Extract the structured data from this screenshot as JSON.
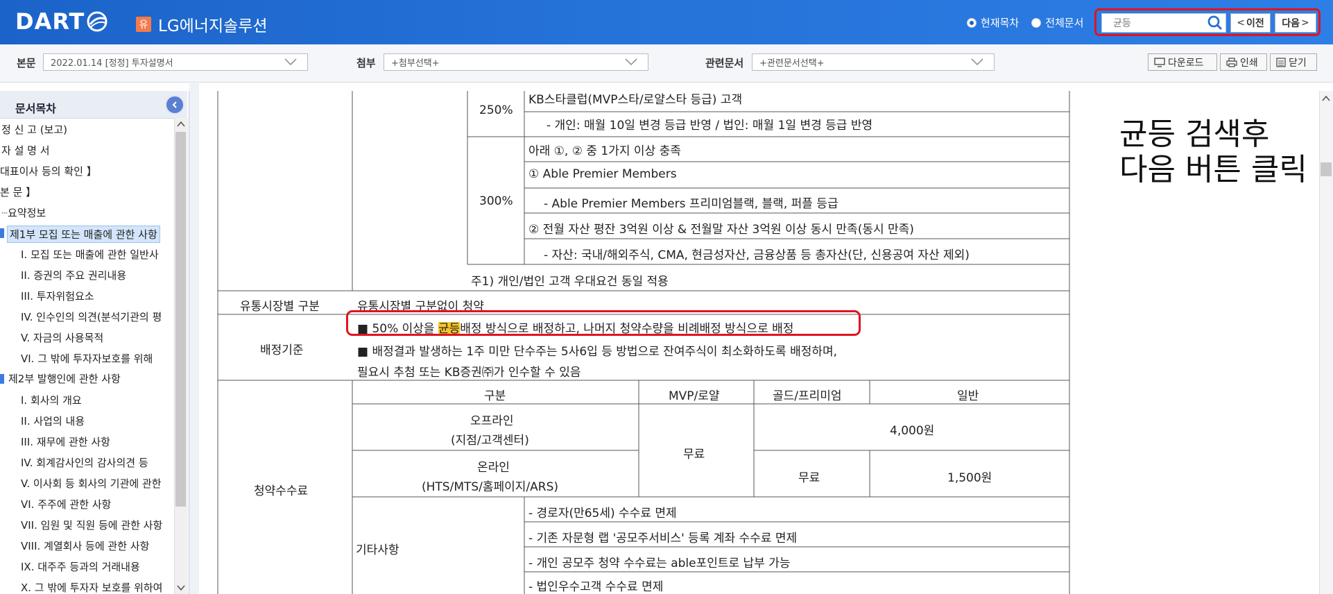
{
  "header": {
    "logo_text": "DART",
    "doc_badge": "유",
    "company_name": "LG에너지솔루션",
    "radio_current": "현재목차",
    "radio_all": "전체문서",
    "search_value": "균등",
    "prev_label": "이전",
    "next_label": "다음"
  },
  "toolbar": {
    "main_label": "본문",
    "main_select": "2022.01.14  [정정] 투자설명서",
    "attach_label": "첨부",
    "attach_select": "+첨부선택+",
    "related_label": "관련문서",
    "related_select": "+관련문서선택+",
    "download": "다운로드",
    "print": "인쇄",
    "close": "닫기"
  },
  "sidebar": {
    "title": "문서목차",
    "items": [
      "정 신 고 (보고)",
      "자 설 명 서",
      "대표이사 등의 확인 】",
      "본 문 】",
      "요약정보",
      "제1부 모집 또는 매출에 관한 사항",
      "I. 모집 또는 매출에 관한 일반사",
      "II. 증권의 주요 권리내용",
      "III. 투자위험요소",
      "IV. 인수인의 의견(분석기관의 평",
      "V. 자금의 사용목적",
      "VI. 그 밖에 투자자보호를 위해",
      "제2부 발행인에 관한 사항",
      "I. 회사의 개요",
      "II. 사업의 내용",
      "III. 재무에 관한 사항",
      "IV. 회계감사인의 감사의견 등",
      "V. 이사회 등 회사의 기관에 관한",
      "VI. 주주에 관한 사항",
      "VII. 임원 및 직원 등에 관한 사항",
      "VIII. 계열회사 등에 관한 사항",
      "IX. 대주주 등과의 거래내용",
      "X. 그 밖에 투자자 보호를 위하여"
    ]
  },
  "table": {
    "r250_pct": "250%",
    "r250_line1": "KB스타클럽(MVP스타/로얄스타 등급) 고객",
    "r250_line2": "- 개인: 매월 10일 변경 등급 반영 / 법인: 매월 1일 변경 등급 반영",
    "r300_pct": "300%",
    "r300_line1": "아래 ①, ② 중 1가지 이상 충족",
    "r300_line2": "① Able Premier Members",
    "r300_line3": "- Able Premier Members 프리미엄블랙, 블랙, 퍼플 등급",
    "r300_line4": "② 전월 자산 평잔 3억원 이상 & 전월말 자산 3억원 이상 동시 만족(동시 만족)",
    "r300_line5": "- 자산: 국내/해외주식, CMA, 현금성자산, 금융상품 등 총자산(단, 신용공여 자산 제외)",
    "note": "주1) 개인/법인 고객 우대요건 동일 적용",
    "market_label": "유통시장별 구분",
    "market_value": "유통시장별 구분없이 청약",
    "alloc_label": "배정기준",
    "alloc_line1_a": "■ 50% 이상을 ",
    "alloc_line1_hl": "균등",
    "alloc_line1_b": "배정 방식으로 배정하고, 나머지 청약수량을 비례배정 방식으로 배정",
    "alloc_line2": "■ 배정결과 발생하는 1주 미만 단수주는 5사6입 등 방법으로 잔여주식이 최소화하도록 배정하며,",
    "alloc_line3": "필요시 추첨 또는 KB증권㈜가 인수할 수 있음",
    "fee_label": "청약수수료",
    "fee_head_type": "구분",
    "fee_head_mvp": "MVP/로얄",
    "fee_head_gold": "골드/프리미엄",
    "fee_head_general": "일반",
    "offline_1": "오프라인",
    "offline_2": "(지점/고객센터)",
    "online_1": "온라인",
    "online_2": "(HTS/MTS/홈페이지/ARS)",
    "free": "무료",
    "offline_fee": "4,000원",
    "online_gold": "무료",
    "online_general": "1,500원",
    "etc_label": "기타사항",
    "etc_1": "- 경로자(만65세) 수수료 면제",
    "etc_2": "- 기존 자문형 랩 '공모주서비스' 등록 계좌 수수료 면제",
    "etc_3": "- 개인 공모주 청약 수수료는 able포인트로 납부 가능",
    "etc_4": "- 법인우수고객 수수료 면제"
  },
  "annotation": {
    "line1": "균등 검색후",
    "line2": "다음 버튼 클릭"
  }
}
